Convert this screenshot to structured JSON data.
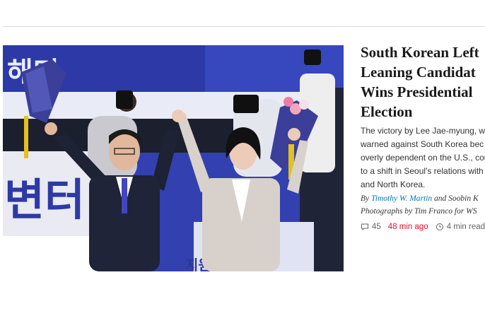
{
  "article": {
    "headline": "South Korean Left\nLeaning Candidat\nWins Presidential\nElection",
    "summary": "The victory by Lee Jae-myung, w\nwarned against South Korea bec\noverly dependent on the U.S., cou\nto a shift in Seoul's relations with\nand North Korea.",
    "byline": {
      "prefix": "By ",
      "author1": "Timothy W. Martin",
      "conjunction": " and Soobin K",
      "photo_credit": "Photographs by Tim Franco for WS"
    },
    "comments_count": "45",
    "timestamp": "48 min ago",
    "read_time": "4 min read",
    "image_texts": {
      "banner_top": "해터",
      "banner_left": "변터",
      "podium": "지원"
    }
  },
  "colors": {
    "stage_blue": "#2f3aa8",
    "timestamp_red": "#e2112e",
    "link_blue": "#0274b6"
  },
  "icons": [
    "comment-icon",
    "clock-icon"
  ]
}
